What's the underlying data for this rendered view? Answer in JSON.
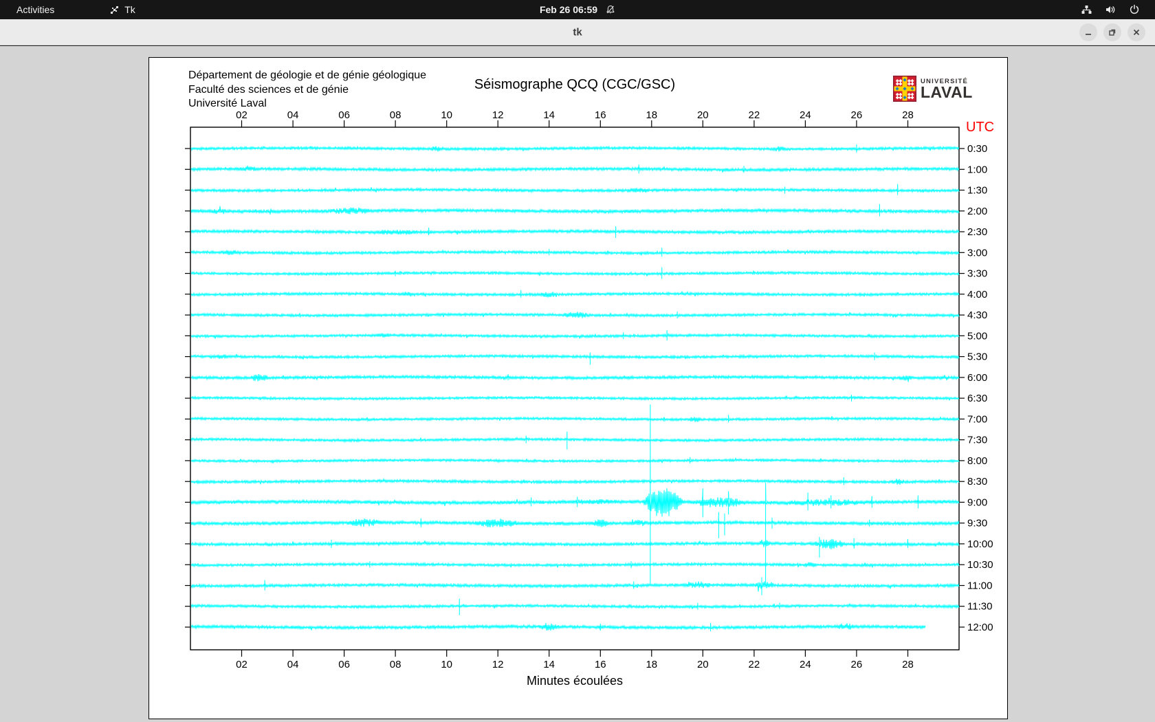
{
  "topbar": {
    "activities_label": "Activities",
    "app_label": "Tk",
    "clock": "Feb 26 06:59"
  },
  "titlebar": {
    "title": "tk"
  },
  "canvas": {
    "header_lines": [
      "Département de géologie et de génie géologique",
      "Faculté des sciences et de génie",
      "Université Laval"
    ],
    "title": "Séismographe QCQ (CGC/GSC)",
    "utc_label": "UTC",
    "xlabel": "Minutes écoulées",
    "logo": {
      "line1": "UNIVERSITÉ",
      "line2": "LAVAL"
    }
  },
  "chart_data": {
    "type": "line",
    "title": "Séismographe QCQ (CGC/GSC)",
    "xlabel": "Minutes écoulées",
    "x_range_minutes": [
      0,
      30
    ],
    "x_ticks": [
      "02",
      "04",
      "06",
      "08",
      "10",
      "12",
      "14",
      "16",
      "18",
      "20",
      "22",
      "24",
      "26",
      "28"
    ],
    "trace_color": "#00ffff",
    "axis_color": "#000000",
    "utc_color": "#ff0000",
    "traces": [
      {
        "label": "0:30",
        "amp": 2.0,
        "bursts": [
          [
            9.2,
            10.0,
            4.5
          ],
          [
            22.6,
            23.4,
            4
          ]
        ],
        "spikes": [
          [
            26.0,
            6,
            6
          ]
        ]
      },
      {
        "label": "1:00",
        "amp": 2.2,
        "bursts": [
          [
            1.5,
            3.0,
            3.5
          ]
        ],
        "spikes": [
          [
            17.5,
            7,
            6
          ],
          [
            21.6,
            5,
            5
          ]
        ]
      },
      {
        "label": "1:30",
        "amp": 2.0,
        "bursts": [
          [
            16.8,
            18.2,
            4
          ]
        ],
        "spikes": [
          [
            27.6,
            9,
            7
          ],
          [
            23.2,
            5,
            5
          ]
        ]
      },
      {
        "label": "2:00",
        "amp": 2.4,
        "bursts": [
          [
            0.5,
            1.8,
            4
          ],
          [
            5.0,
            7.6,
            5
          ]
        ],
        "spikes": [
          [
            26.9,
            10,
            8
          ]
        ]
      },
      {
        "label": "2:30",
        "amp": 2.2,
        "bursts": [
          [
            6.5,
            9.5,
            4
          ]
        ],
        "spikes": [
          [
            9.3,
            6,
            5
          ],
          [
            16.6,
            8,
            9
          ]
        ]
      },
      {
        "label": "3:00",
        "amp": 2.0,
        "bursts": [
          [
            1.0,
            2.2,
            4
          ]
        ],
        "spikes": [
          [
            14.0,
            5,
            4
          ],
          [
            18.4,
            7,
            6
          ]
        ]
      },
      {
        "label": "3:30",
        "amp": 1.9,
        "bursts": [],
        "spikes": [
          [
            8.0,
            4,
            4
          ],
          [
            18.4,
            9,
            8
          ]
        ]
      },
      {
        "label": "4:00",
        "amp": 2.0,
        "bursts": [
          [
            8.0,
            9.0,
            3.5
          ],
          [
            13.5,
            14.5,
            4.5
          ]
        ],
        "spikes": [
          [
            12.9,
            6,
            5
          ]
        ]
      },
      {
        "label": "4:30",
        "amp": 2.0,
        "bursts": [
          [
            14.3,
            15.8,
            5
          ]
        ],
        "spikes": [
          [
            19.0,
            5,
            5
          ]
        ]
      },
      {
        "label": "5:00",
        "amp": 1.9,
        "bursts": [
          [
            7.0,
            8.0,
            3.5
          ]
        ],
        "spikes": [
          [
            16.9,
            5,
            5
          ],
          [
            18.6,
            8,
            7
          ]
        ]
      },
      {
        "label": "5:30",
        "amp": 2.0,
        "bursts": [
          [
            0.8,
            1.6,
            4
          ]
        ],
        "spikes": [
          [
            15.6,
            6,
            12
          ],
          [
            26.7,
            6,
            5
          ]
        ]
      },
      {
        "label": "6:00",
        "amp": 2.2,
        "bursts": [
          [
            2.2,
            3.2,
            5.5
          ],
          [
            27.5,
            28.3,
            4.5
          ]
        ],
        "spikes": [
          [
            12.4,
            5,
            4
          ]
        ]
      },
      {
        "label": "6:30",
        "amp": 1.8,
        "bursts": [],
        "spikes": [
          [
            25.8,
            5,
            5
          ]
        ]
      },
      {
        "label": "7:00",
        "amp": 1.9,
        "bursts": [
          [
            19.3,
            20.1,
            4
          ]
        ],
        "spikes": [
          [
            21.0,
            6,
            5
          ]
        ]
      },
      {
        "label": "7:30",
        "amp": 1.9,
        "bursts": [],
        "spikes": [
          [
            13.1,
            6,
            5
          ],
          [
            14.7,
            12,
            14
          ]
        ]
      },
      {
        "label": "8:00",
        "amp": 1.8,
        "bursts": [],
        "spikes": [
          [
            19.5,
            5,
            4
          ]
        ]
      },
      {
        "label": "8:30",
        "amp": 2.0,
        "bursts": [
          [
            10.3,
            11.0,
            3.5
          ],
          [
            27.2,
            28.0,
            5
          ]
        ],
        "spikes": [
          [
            25.5,
            6,
            5
          ]
        ]
      },
      {
        "label": "9:00",
        "amp": 2.6,
        "bursts": [
          [
            14.0,
            17.5,
            4
          ],
          [
            17.6,
            19.3,
            24
          ],
          [
            19.3,
            22.0,
            8
          ],
          [
            22.0,
            27.5,
            5
          ]
        ],
        "spikes": [
          [
            13.3,
            7,
            6
          ],
          [
            15.1,
            8,
            7
          ],
          [
            17.95,
            142,
            120
          ],
          [
            20.0,
            20,
            22
          ],
          [
            21.0,
            16,
            18
          ],
          [
            22.45,
            28,
            118
          ],
          [
            24.1,
            14,
            12
          ],
          [
            25.0,
            10,
            9
          ],
          [
            26.6,
            9,
            8
          ],
          [
            28.4,
            10,
            9
          ]
        ]
      },
      {
        "label": "9:30",
        "amp": 2.4,
        "bursts": [
          [
            5.8,
            7.8,
            6
          ],
          [
            10.8,
            13.2,
            7
          ],
          [
            15.5,
            16.5,
            6
          ],
          [
            17.0,
            18.0,
            5
          ]
        ],
        "spikes": [
          [
            9.0,
            7,
            6
          ],
          [
            20.62,
            16,
            22
          ],
          [
            20.85,
            14,
            18
          ],
          [
            22.7,
            8,
            8
          ],
          [
            26.5,
            5,
            5
          ]
        ]
      },
      {
        "label": "10:00",
        "amp": 2.2,
        "bursts": [
          [
            22.1,
            22.7,
            6
          ],
          [
            24.2,
            25.7,
            8
          ]
        ],
        "spikes": [
          [
            5.5,
            6,
            6
          ],
          [
            24.55,
            10,
            20
          ],
          [
            25.9,
            8,
            7
          ],
          [
            28.0,
            7,
            6
          ]
        ]
      },
      {
        "label": "10:30",
        "amp": 2.0,
        "bursts": [
          [
            23.8,
            24.6,
            4
          ]
        ],
        "spikes": [
          [
            7.0,
            5,
            4
          ],
          [
            17.2,
            5,
            5
          ]
        ]
      },
      {
        "label": "11:00",
        "amp": 2.2,
        "bursts": [
          [
            19.2,
            20.5,
            5.5
          ],
          [
            21.9,
            22.9,
            7
          ]
        ],
        "spikes": [
          [
            2.9,
            8,
            7
          ],
          [
            17.3,
            6,
            5
          ],
          [
            22.3,
            12,
            14
          ]
        ]
      },
      {
        "label": "11:30",
        "amp": 2.0,
        "bursts": [],
        "spikes": [
          [
            10.5,
            11,
            13
          ],
          [
            19.8,
            5,
            5
          ],
          [
            23.0,
            5,
            4
          ]
        ]
      },
      {
        "label": "12:00",
        "amp": 2.3,
        "end_minute": 28.7,
        "bursts": [
          [
            13.4,
            14.6,
            6
          ],
          [
            25.0,
            26.2,
            5
          ]
        ],
        "spikes": [
          [
            16.0,
            5,
            5
          ],
          [
            20.3,
            6,
            6
          ]
        ]
      }
    ]
  }
}
